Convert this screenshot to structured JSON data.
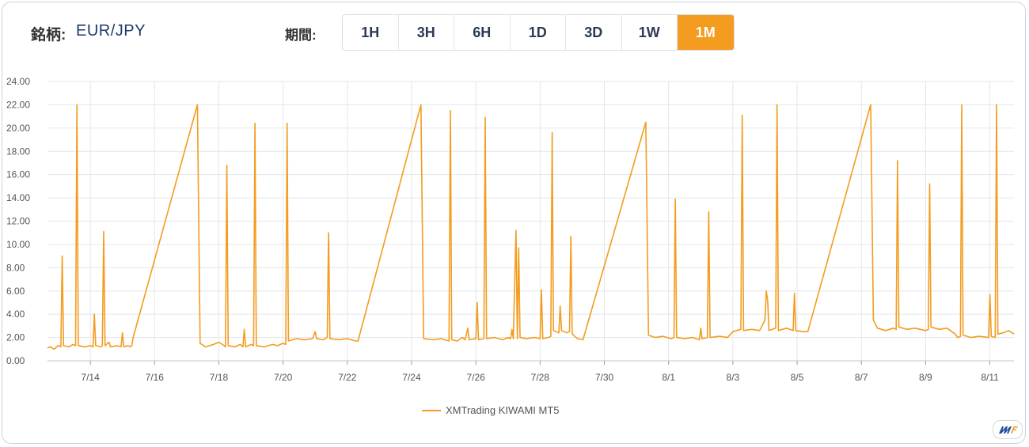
{
  "header": {
    "symbol_label": "銘柄:",
    "symbol_value": "EUR/JPY",
    "period_label": "期間:",
    "periods": [
      "1H",
      "3H",
      "6H",
      "1D",
      "3D",
      "1W",
      "1M"
    ],
    "active_period": "1M"
  },
  "colors": {
    "accent": "#f39c1f",
    "grid": "#e3e6ea",
    "axis_text": "#555555"
  },
  "logo_icon": "mf-logo-icon",
  "chart_data": {
    "type": "line",
    "title": "",
    "xlabel": "",
    "ylabel": "",
    "ylim": [
      0,
      24
    ],
    "yticks": [
      "0.00",
      "2.00",
      "4.00",
      "6.00",
      "8.00",
      "10.00",
      "12.00",
      "14.00",
      "16.00",
      "18.00",
      "20.00",
      "22.00",
      "24.00"
    ],
    "xlim": [
      "2025-07-12T16:00",
      "2025-08-11T18:00"
    ],
    "xticks": [
      {
        "date": "2025-07-14",
        "label": "7/14"
      },
      {
        "date": "2025-07-16",
        "label": "7/16"
      },
      {
        "date": "2025-07-18",
        "label": "7/18"
      },
      {
        "date": "2025-07-20",
        "label": "7/20"
      },
      {
        "date": "2025-07-22",
        "label": "7/22"
      },
      {
        "date": "2025-07-24",
        "label": "7/24"
      },
      {
        "date": "2025-07-26",
        "label": "7/26"
      },
      {
        "date": "2025-07-28",
        "label": "7/28"
      },
      {
        "date": "2025-07-30",
        "label": "7/30"
      },
      {
        "date": "2025-08-01",
        "label": "8/1"
      },
      {
        "date": "2025-08-03",
        "label": "8/3"
      },
      {
        "date": "2025-08-05",
        "label": "8/5"
      },
      {
        "date": "2025-08-07",
        "label": "8/7"
      },
      {
        "date": "2025-08-09",
        "label": "8/9"
      },
      {
        "date": "2025-08-11",
        "label": "8/11"
      }
    ],
    "legend": {
      "position": "bottom-center"
    },
    "grid": true,
    "series": [
      {
        "name": "XMTrading KIWAMI MT5",
        "points": [
          [
            "2025-07-12T16:00",
            1.1
          ],
          [
            "2025-07-12T18:00",
            1.2
          ],
          [
            "2025-07-12T21:00",
            1.0
          ],
          [
            "2025-07-13T00:00",
            1.3
          ],
          [
            "2025-07-13T02:00",
            1.2
          ],
          [
            "2025-07-13T03:00",
            9.0
          ],
          [
            "2025-07-13T04:00",
            1.3
          ],
          [
            "2025-07-13T08:00",
            1.2
          ],
          [
            "2025-07-13T11:00",
            1.4
          ],
          [
            "2025-07-13T13:00",
            1.3
          ],
          [
            "2025-07-13T14:00",
            22.0
          ],
          [
            "2025-07-13T15:00",
            1.3
          ],
          [
            "2025-07-13T20:00",
            1.2
          ],
          [
            "2025-07-14T00:00",
            1.3
          ],
          [
            "2025-07-14T02:00",
            1.2
          ],
          [
            "2025-07-14T03:00",
            4.0
          ],
          [
            "2025-07-14T04:00",
            1.3
          ],
          [
            "2025-07-14T08:00",
            1.2
          ],
          [
            "2025-07-14T09:00",
            1.3
          ],
          [
            "2025-07-14T10:00",
            11.1
          ],
          [
            "2025-07-14T11:00",
            1.3
          ],
          [
            "2025-07-14T14:00",
            1.6
          ],
          [
            "2025-07-14T15:00",
            1.2
          ],
          [
            "2025-07-14T20:00",
            1.3
          ],
          [
            "2025-07-14T23:00",
            1.2
          ],
          [
            "2025-07-15T00:00",
            2.4
          ],
          [
            "2025-07-15T01:00",
            1.2
          ],
          [
            "2025-07-15T04:00",
            1.3
          ],
          [
            "2025-07-15T06:00",
            1.2
          ],
          [
            "2025-07-15T07:00",
            1.3
          ],
          [
            "2025-07-15T08:00",
            2.0
          ],
          [
            "2025-07-17T08:00",
            22.0
          ],
          [
            "2025-07-17T10:00",
            1.5
          ],
          [
            "2025-07-17T14:00",
            1.2
          ],
          [
            "2025-07-17T20:00",
            1.4
          ],
          [
            "2025-07-18T00:00",
            1.6
          ],
          [
            "2025-07-18T04:00",
            1.3
          ],
          [
            "2025-07-18T05:00",
            1.2
          ],
          [
            "2025-07-18T06:00",
            16.8
          ],
          [
            "2025-07-18T07:00",
            1.3
          ],
          [
            "2025-07-18T12:00",
            1.2
          ],
          [
            "2025-07-18T16:00",
            1.4
          ],
          [
            "2025-07-18T18:00",
            1.2
          ],
          [
            "2025-07-18T19:00",
            2.7
          ],
          [
            "2025-07-18T20:00",
            1.2
          ],
          [
            "2025-07-19T00:00",
            1.4
          ],
          [
            "2025-07-19T02:00",
            1.3
          ],
          [
            "2025-07-19T03:00",
            20.4
          ],
          [
            "2025-07-19T04:00",
            1.3
          ],
          [
            "2025-07-19T10:00",
            1.2
          ],
          [
            "2025-07-19T16:00",
            1.4
          ],
          [
            "2025-07-19T20:00",
            1.3
          ],
          [
            "2025-07-20T00:00",
            1.5
          ],
          [
            "2025-07-20T02:00",
            1.4
          ],
          [
            "2025-07-20T03:00",
            20.4
          ],
          [
            "2025-07-20T04:00",
            1.7
          ],
          [
            "2025-07-20T10:00",
            1.9
          ],
          [
            "2025-07-20T16:00",
            1.8
          ],
          [
            "2025-07-20T22:00",
            1.9
          ],
          [
            "2025-07-21T00:00",
            2.5
          ],
          [
            "2025-07-21T01:00",
            1.9
          ],
          [
            "2025-07-21T06:00",
            1.8
          ],
          [
            "2025-07-21T09:00",
            2.0
          ],
          [
            "2025-07-21T10:00",
            11.0
          ],
          [
            "2025-07-21T11:00",
            1.9
          ],
          [
            "2025-07-21T18:00",
            1.8
          ],
          [
            "2025-07-22T00:00",
            1.9
          ],
          [
            "2025-07-22T06:00",
            1.7
          ],
          [
            "2025-07-22T08:00",
            1.7
          ],
          [
            "2025-07-24T07:00",
            22.0
          ],
          [
            "2025-07-24T09:00",
            1.9
          ],
          [
            "2025-07-24T16:00",
            1.8
          ],
          [
            "2025-07-24T22:00",
            1.9
          ],
          [
            "2025-07-25T04:00",
            1.7
          ],
          [
            "2025-07-25T05:00",
            21.5
          ],
          [
            "2025-07-25T06:00",
            1.8
          ],
          [
            "2025-07-25T10:00",
            1.7
          ],
          [
            "2025-07-25T14:00",
            2.0
          ],
          [
            "2025-07-25T16:00",
            1.8
          ],
          [
            "2025-07-25T18:00",
            2.8
          ],
          [
            "2025-07-25T19:00",
            1.8
          ],
          [
            "2025-07-26T00:00",
            1.9
          ],
          [
            "2025-07-26T01:00",
            5.0
          ],
          [
            "2025-07-26T02:00",
            1.8
          ],
          [
            "2025-07-26T06:00",
            1.9
          ],
          [
            "2025-07-26T07:00",
            20.9
          ],
          [
            "2025-07-26T08:00",
            1.9
          ],
          [
            "2025-07-26T14:00",
            2.0
          ],
          [
            "2025-07-26T20:00",
            1.8
          ],
          [
            "2025-07-27T00:00",
            2.0
          ],
          [
            "2025-07-27T02:00",
            1.9
          ],
          [
            "2025-07-27T03:00",
            2.7
          ],
          [
            "2025-07-27T04:00",
            1.9
          ],
          [
            "2025-07-27T06:00",
            11.2
          ],
          [
            "2025-07-27T07:00",
            1.9
          ],
          [
            "2025-07-27T08:00",
            9.7
          ],
          [
            "2025-07-27T09:00",
            2.0
          ],
          [
            "2025-07-27T14:00",
            1.9
          ],
          [
            "2025-07-27T20:00",
            2.0
          ],
          [
            "2025-07-28T00:00",
            1.9
          ],
          [
            "2025-07-28T01:00",
            6.1
          ],
          [
            "2025-07-28T02:00",
            1.9
          ],
          [
            "2025-07-28T06:00",
            2.0
          ],
          [
            "2025-07-28T08:00",
            2.1
          ],
          [
            "2025-07-28T09:00",
            19.6
          ],
          [
            "2025-07-28T10:00",
            2.6
          ],
          [
            "2025-07-28T14:00",
            2.4
          ],
          [
            "2025-07-28T15:00",
            4.7
          ],
          [
            "2025-07-28T16:00",
            2.6
          ],
          [
            "2025-07-28T20:00",
            2.4
          ],
          [
            "2025-07-28T22:00",
            2.5
          ],
          [
            "2025-07-28T23:00",
            10.7
          ],
          [
            "2025-07-29T00:00",
            2.3
          ],
          [
            "2025-07-29T04:00",
            1.9
          ],
          [
            "2025-07-29T08:00",
            1.8
          ],
          [
            "2025-07-31T07:00",
            20.5
          ],
          [
            "2025-07-31T09:00",
            2.2
          ],
          [
            "2025-07-31T14:00",
            2.0
          ],
          [
            "2025-07-31T20:00",
            2.1
          ],
          [
            "2025-08-01T02:00",
            1.9
          ],
          [
            "2025-08-01T04:00",
            2.0
          ],
          [
            "2025-08-01T05:00",
            13.9
          ],
          [
            "2025-08-01T06:00",
            2.0
          ],
          [
            "2025-08-01T12:00",
            1.9
          ],
          [
            "2025-08-01T18:00",
            2.0
          ],
          [
            "2025-08-01T23:00",
            1.8
          ],
          [
            "2025-08-02T00:00",
            2.8
          ],
          [
            "2025-08-02T01:00",
            1.9
          ],
          [
            "2025-08-02T05:00",
            2.0
          ],
          [
            "2025-08-02T06:00",
            12.8
          ],
          [
            "2025-08-02T07:00",
            2.0
          ],
          [
            "2025-08-02T14:00",
            2.1
          ],
          [
            "2025-08-02T20:00",
            2.0
          ],
          [
            "2025-08-03T00:00",
            2.5
          ],
          [
            "2025-08-03T06:00",
            2.7
          ],
          [
            "2025-08-03T07:00",
            21.1
          ],
          [
            "2025-08-03T08:00",
            2.6
          ],
          [
            "2025-08-03T14:00",
            2.7
          ],
          [
            "2025-08-03T20:00",
            2.6
          ],
          [
            "2025-08-04T00:00",
            3.5
          ],
          [
            "2025-08-04T01:00",
            6.0
          ],
          [
            "2025-08-04T02:00",
            5.2
          ],
          [
            "2025-08-04T03:00",
            2.6
          ],
          [
            "2025-08-04T08:00",
            2.8
          ],
          [
            "2025-08-04T09:00",
            22.0
          ],
          [
            "2025-08-04T10:00",
            2.6
          ],
          [
            "2025-08-04T16:00",
            2.8
          ],
          [
            "2025-08-04T21:00",
            2.6
          ],
          [
            "2025-08-04T22:00",
            5.8
          ],
          [
            "2025-08-04T23:00",
            2.6
          ],
          [
            "2025-08-05T04:00",
            2.5
          ],
          [
            "2025-08-05T08:00",
            2.5
          ],
          [
            "2025-08-07T07:00",
            22.0
          ],
          [
            "2025-08-07T09:00",
            3.5
          ],
          [
            "2025-08-07T12:00",
            2.8
          ],
          [
            "2025-08-07T18:00",
            2.6
          ],
          [
            "2025-08-08T00:00",
            2.8
          ],
          [
            "2025-08-08T02:00",
            2.7
          ],
          [
            "2025-08-08T03:00",
            17.2
          ],
          [
            "2025-08-08T04:00",
            2.9
          ],
          [
            "2025-08-08T10:00",
            2.7
          ],
          [
            "2025-08-08T16:00",
            2.8
          ],
          [
            "2025-08-09T00:00",
            2.6
          ],
          [
            "2025-08-09T02:00",
            2.7
          ],
          [
            "2025-08-09T03:00",
            15.2
          ],
          [
            "2025-08-09T04:00",
            2.9
          ],
          [
            "2025-08-09T10:00",
            2.7
          ],
          [
            "2025-08-09T16:00",
            2.8
          ],
          [
            "2025-08-09T22:00",
            2.3
          ],
          [
            "2025-08-10T00:00",
            2.0
          ],
          [
            "2025-08-10T02:00",
            2.1
          ],
          [
            "2025-08-10T03:00",
            22.0
          ],
          [
            "2025-08-10T04:00",
            2.2
          ],
          [
            "2025-08-10T10:00",
            2.0
          ],
          [
            "2025-08-10T16:00",
            2.1
          ],
          [
            "2025-08-10T23:00",
            2.0
          ],
          [
            "2025-08-11T00:00",
            5.7
          ],
          [
            "2025-08-11T01:00",
            2.1
          ],
          [
            "2025-08-11T04:00",
            2.0
          ],
          [
            "2025-08-11T05:00",
            22.0
          ],
          [
            "2025-08-11T06:00",
            2.3
          ],
          [
            "2025-08-11T10:00",
            2.4
          ],
          [
            "2025-08-11T14:00",
            2.6
          ],
          [
            "2025-08-11T18:00",
            2.3
          ]
        ]
      }
    ]
  }
}
